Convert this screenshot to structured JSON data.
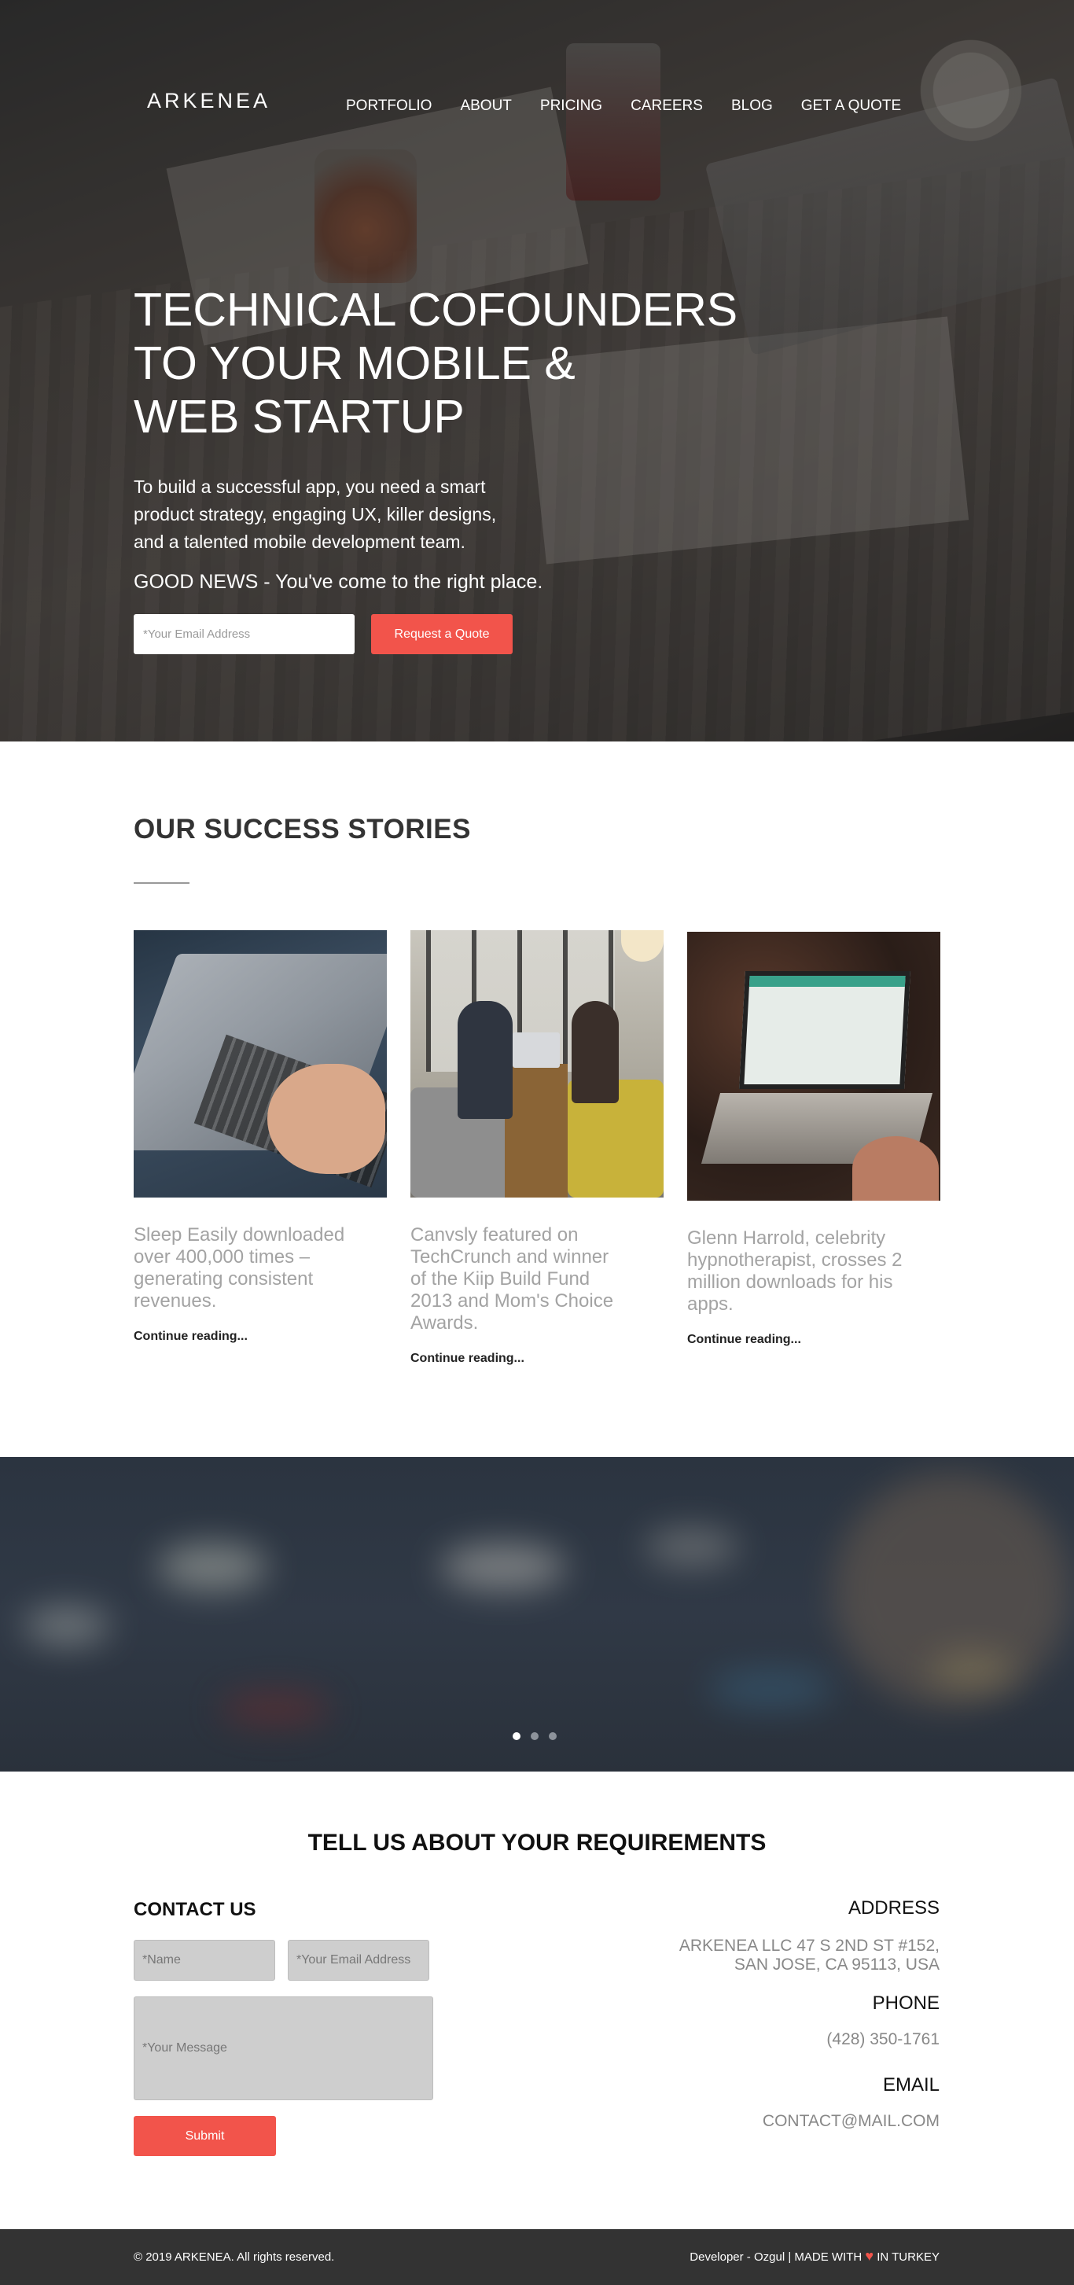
{
  "brand": {
    "logo": "ARKENEA",
    "accent_color": "#f2544b"
  },
  "nav": [
    "PORTFOLIO",
    "ABOUT",
    "PRICING",
    "CAREERS",
    "BLOG",
    "GET A QUOTE"
  ],
  "hero": {
    "title_lines": [
      "TECHNICAL COFOUNDERS",
      "TO YOUR MOBILE &",
      "WEB STARTUP"
    ],
    "description_lines": [
      "To build a successful app, you need a smart",
      "product strategy, engaging UX, killer designs,",
      "and a talented mobile development team."
    ],
    "good_news": "GOOD NEWS - You've come to the right place.",
    "email_placeholder": "*Your Email Address",
    "cta": "Request a Quote"
  },
  "stories": {
    "title": "OUR SUCCESS STORIES",
    "items": [
      {
        "lines": [
          "Sleep Easily downloaded",
          "over 400,000 times –",
          "generating consistent",
          "revenues."
        ],
        "link": "Continue reading..."
      },
      {
        "lines": [
          "Canvsly featured on",
          "TechCrunch and winner",
          "of the Kiip Build Fund",
          "2013 and Mom's Choice",
          "Awards."
        ],
        "link": "Continue reading..."
      },
      {
        "lines": [
          "Glenn Harrold, celebrity",
          "hypnotherapist, crosses 2",
          "million downloads for his",
          "apps."
        ],
        "link": "Continue reading..."
      }
    ]
  },
  "slider": {
    "slide_count": 3,
    "active_index": 0
  },
  "requirements": {
    "title": "TELL US ABOUT YOUR REQUIREMENTS",
    "contact_heading": "CONTACT US",
    "name_placeholder": "*Name",
    "email_placeholder": "*Your Email Address",
    "message_placeholder": "*Your Message",
    "submit": "Submit",
    "address_heading": "ADDRESS",
    "address_lines": [
      "ARKENEA LLC 47 S 2ND ST #152,",
      "SAN JOSE, CA 95113, USA"
    ],
    "phone_heading": "PHONE",
    "phone": "(428) 350-1761",
    "email_heading": "EMAIL",
    "email": "CONTACT@MAIL.COM"
  },
  "footer": {
    "copyright": "© 2019 ARKENEA. All rights reserved.",
    "credit_prefix": "Developer - Ozgul | MADE WITH",
    "credit_suffix": "IN TURKEY",
    "heart_icon": "heart-icon"
  }
}
